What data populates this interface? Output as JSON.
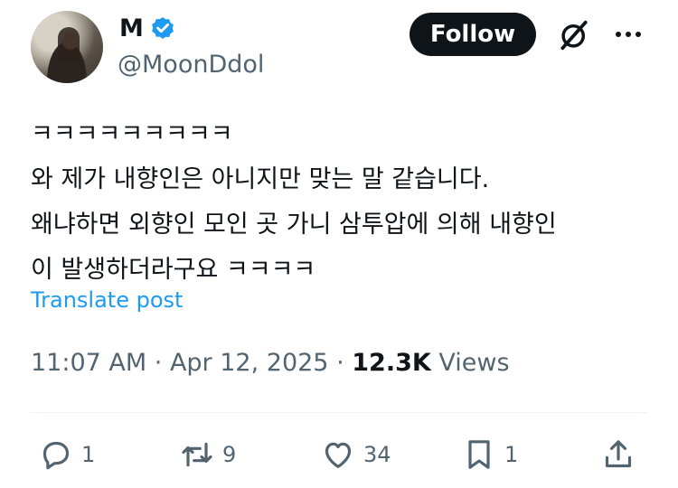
{
  "author": {
    "display_name": "M",
    "handle": "@MoonDdol",
    "verified": true,
    "accent_color": "#1d9bf0"
  },
  "header": {
    "follow_label": "Follow"
  },
  "post": {
    "text": "ㅋㅋㅋㅋㅋㅋㅋㅋㅋ\n와 제가 내향인은 아니지만 맞는 말 같습니다.\n왜냐하면 외향인 모인 곳 가니 삼투압에 의해 내향인\n이 발생하더라구요 ㅋㅋㅋㅋ",
    "translate_label": "Translate post"
  },
  "meta": {
    "time": "11:07 AM",
    "separator": "·",
    "date": "Apr 12, 2025",
    "views_count": "12.3K",
    "views_label": "Views"
  },
  "actions": {
    "replies": "1",
    "reposts": "9",
    "likes": "34",
    "bookmarks": "1"
  },
  "icons": [
    "verified-icon",
    "grok-icon",
    "more-icon",
    "reply-icon",
    "repost-icon",
    "like-icon",
    "bookmark-icon",
    "share-icon"
  ]
}
